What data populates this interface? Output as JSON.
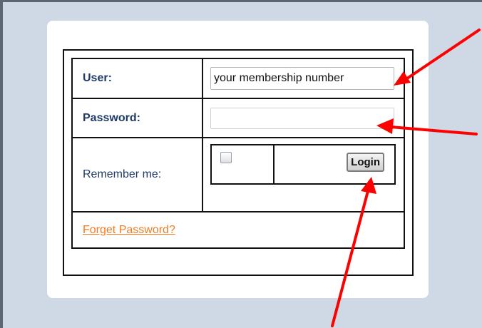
{
  "form": {
    "user_label": "User:",
    "user_value": "your membership number",
    "password_label": "Password:",
    "password_value": "",
    "remember_label": "Remember me:",
    "remember_checked": false,
    "login_label": "Login",
    "forgot_label": "Forget Password?"
  },
  "colors": {
    "background": "#cfd9e5",
    "label": "#1f3b66",
    "link": "#f47a20",
    "arrow": "#ff0000"
  },
  "annotations": {
    "arrow_count": 3,
    "arrow_targets": [
      "user-input",
      "password-input",
      "login-button"
    ]
  }
}
